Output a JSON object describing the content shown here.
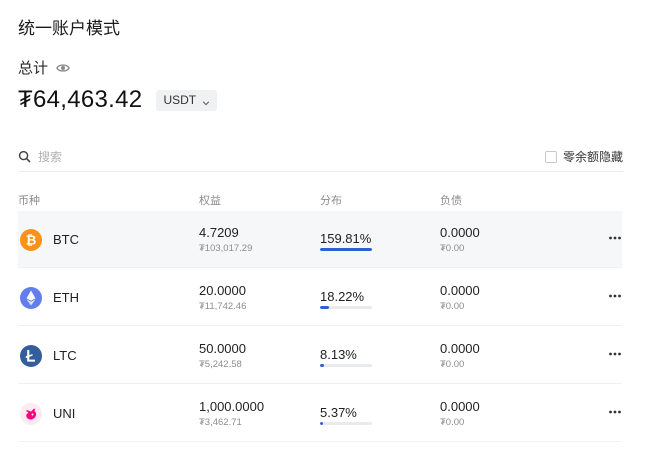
{
  "page_title": "统一账户模式",
  "total": {
    "label": "总计",
    "eye_icon": "eye-icon",
    "amount": "₮64,463.42",
    "currency": "USDT"
  },
  "search": {
    "placeholder": "搜索"
  },
  "hide_zero_label": "零余额隐藏",
  "columns": {
    "coin": "币种",
    "equity": "权益",
    "distribution": "分布",
    "debt": "负债"
  },
  "colors": {
    "accent": "#2f5fd8",
    "btc": "#f7931a",
    "eth": "#627eea",
    "ltc": "#345d9d",
    "uni": "#ff007a"
  },
  "assets": [
    {
      "name": "BTC",
      "icon": "btc-icon",
      "equity": "4.7209",
      "equity_value": "₮103,017.29",
      "distribution": "159.81%",
      "distribution_level": 100,
      "debt": "0.0000",
      "debt_value": "₮0.00"
    },
    {
      "name": "ETH",
      "icon": "eth-icon",
      "equity": "20.0000",
      "equity_value": "₮11,742.46",
      "distribution": "18.22%",
      "distribution_level": 18.22,
      "debt": "0.0000",
      "debt_value": "₮0.00"
    },
    {
      "name": "LTC",
      "icon": "ltc-icon",
      "equity": "50.0000",
      "equity_value": "₮5,242.58",
      "distribution": "8.13%",
      "distribution_level": 8.13,
      "debt": "0.0000",
      "debt_value": "₮0.00"
    },
    {
      "name": "UNI",
      "icon": "uni-icon",
      "equity": "1,000.0000",
      "equity_value": "₮3,462.71",
      "distribution": "5.37%",
      "distribution_level": 5.37,
      "debt": "0.0000",
      "debt_value": "₮0.00"
    }
  ]
}
